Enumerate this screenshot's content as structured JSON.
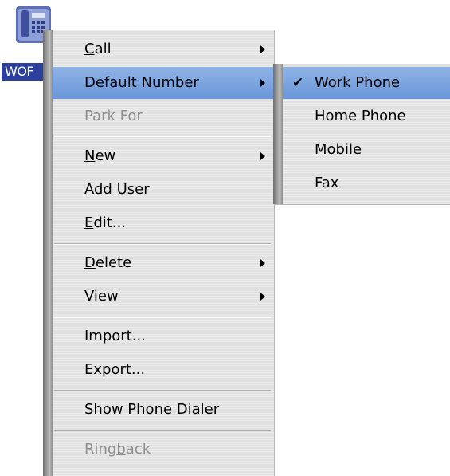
{
  "desktop_icon": {
    "label": "WOF",
    "icon": "phone-icon"
  },
  "main_menu": {
    "items": [
      {
        "id": "call",
        "pre": "",
        "ul": "C",
        "post": "all",
        "submenu": true
      },
      {
        "id": "default-number",
        "pre": "Default Number",
        "ul": "",
        "post": "",
        "submenu": true,
        "selected": true
      },
      {
        "id": "park-for",
        "pre": "Park For",
        "ul": "",
        "post": "",
        "disabled": true
      },
      {
        "id": "new",
        "pre": "",
        "ul": "N",
        "post": "ew",
        "submenu": true
      },
      {
        "id": "add-user",
        "pre": "",
        "ul": "A",
        "post": "dd User"
      },
      {
        "id": "edit",
        "pre": "",
        "ul": "E",
        "post": "dit..."
      },
      {
        "id": "delete",
        "pre": "",
        "ul": "D",
        "post": "elete",
        "submenu": true
      },
      {
        "id": "view",
        "pre": "View",
        "ul": "",
        "post": "",
        "submenu": true
      },
      {
        "id": "import",
        "pre": "Import...",
        "ul": "",
        "post": ""
      },
      {
        "id": "export",
        "pre": "Export...",
        "ul": "",
        "post": ""
      },
      {
        "id": "show-phone-dialer",
        "pre": "Show Phone Dialer",
        "ul": "",
        "post": ""
      },
      {
        "id": "ringback",
        "pre": "Ring",
        "ul": "b",
        "post": "ack",
        "disabled": true
      }
    ]
  },
  "sub_menu": {
    "items": [
      {
        "id": "work-phone",
        "label": "Work Phone",
        "checked": true,
        "selected": true
      },
      {
        "id": "home-phone",
        "label": "Home Phone"
      },
      {
        "id": "mobile",
        "label": "Mobile"
      },
      {
        "id": "fax",
        "label": "Fax"
      }
    ]
  },
  "colors": {
    "highlight": "#7aa4de",
    "disabled_text": "#8f8f8f",
    "desk_label_bg": "#2b3f9e"
  }
}
